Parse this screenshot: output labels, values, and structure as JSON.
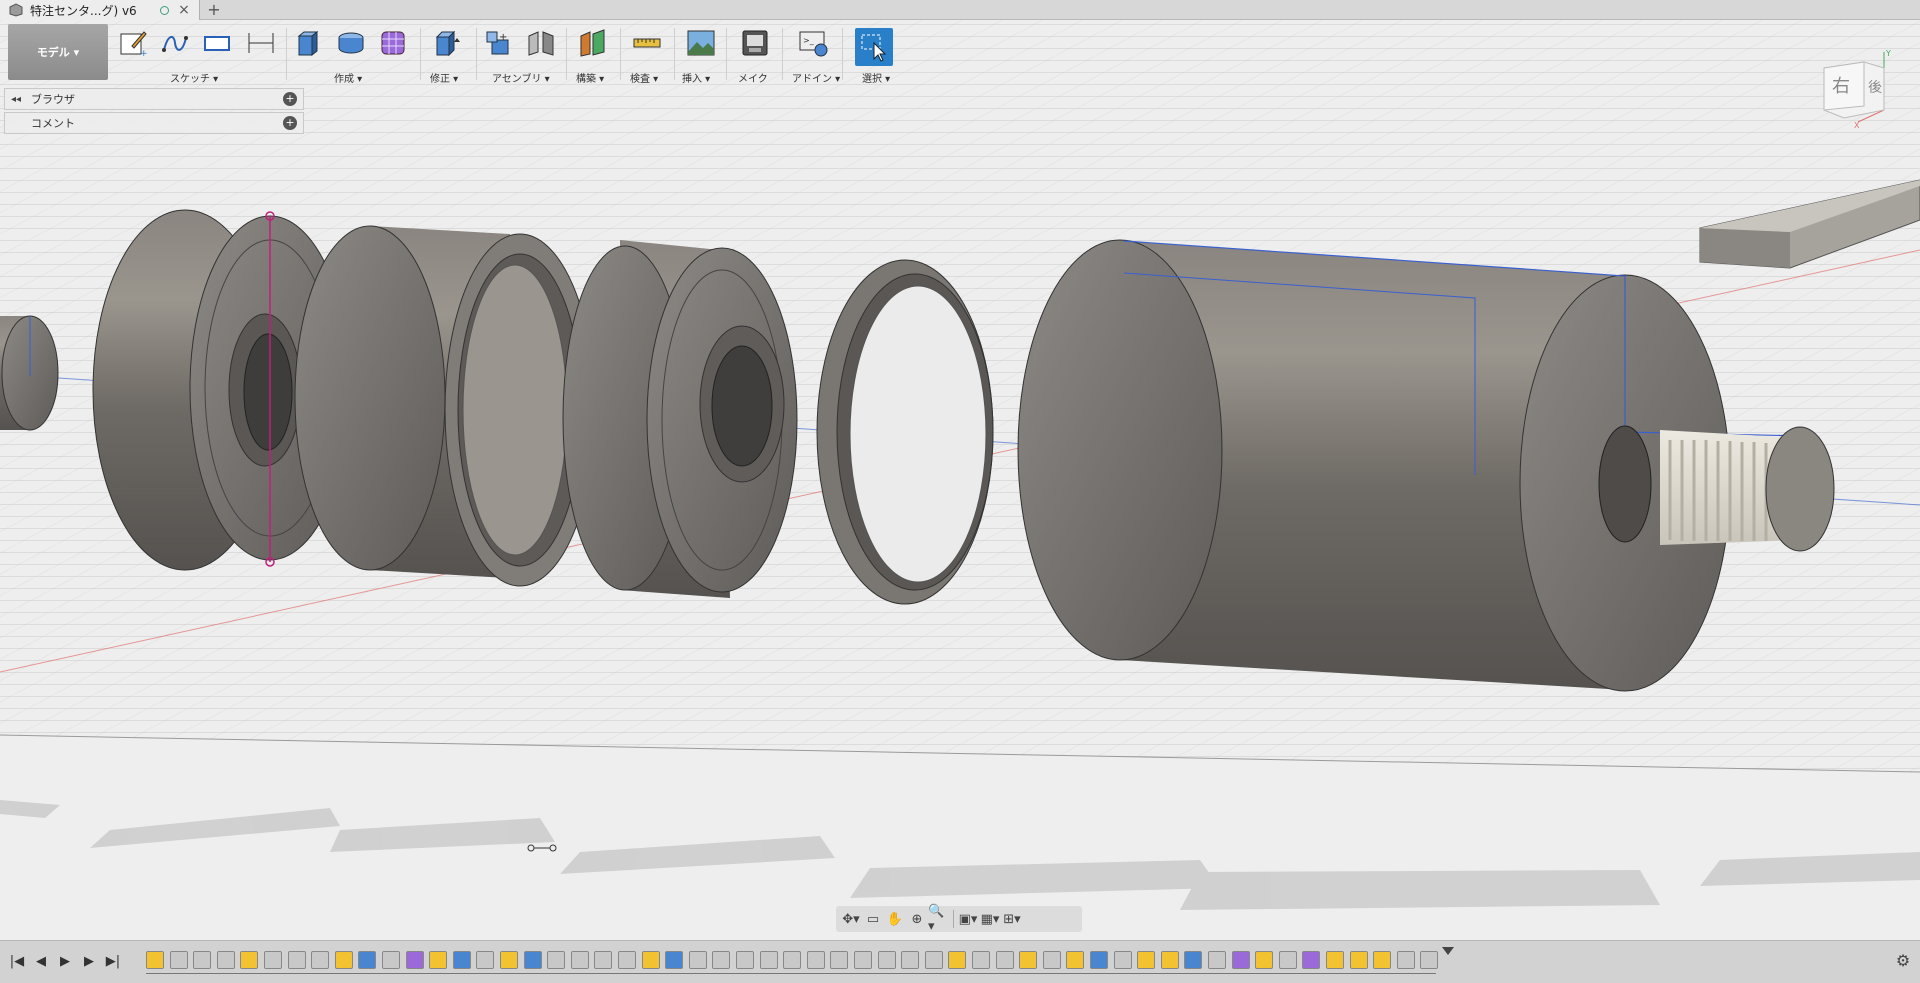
{
  "window": {
    "tab_title": "特注センタ...グ) v6",
    "new_tab": "+",
    "close_glyph": "×"
  },
  "toolbar": {
    "workspace_label": "モデル ▾",
    "groups": [
      {
        "label": "スケッチ ▾"
      },
      {
        "label": "作成 ▾"
      },
      {
        "label": "修正 ▾"
      },
      {
        "label": "アセンブリ ▾"
      },
      {
        "label": "構築 ▾"
      },
      {
        "label": "検査 ▾"
      },
      {
        "label": "挿入 ▾"
      },
      {
        "label": "メイク"
      },
      {
        "label": "アドイン ▾"
      },
      {
        "label": "選択 ▾"
      }
    ],
    "icons": [
      "create-sketch-icon",
      "spline-icon",
      "rectangle-icon",
      "dimension-icon",
      "extrude-icon",
      "revolve-icon",
      "form-icon",
      "press-pull-icon",
      "new-component-icon",
      "joint-icon",
      "offset-plane-icon",
      "measure-icon",
      "insert-image-icon",
      "make-icon",
      "scripts-icon",
      "select-icon"
    ],
    "accent": "#2a80c8"
  },
  "browser": {
    "label": "ブラウザ",
    "comments_label": "コメント"
  },
  "viewcube": {
    "front_face": "右",
    "side_face": "後",
    "axis_x": "X",
    "axis_y": "Y"
  },
  "navbar": {
    "icons": [
      "orbit-icon",
      "look-at-icon",
      "pan-icon",
      "zoom-icon",
      "fit-icon",
      "display-settings-icon",
      "grid-icon",
      "viewports-icon"
    ]
  },
  "timeline": {
    "controls": [
      "|◀",
      "◀",
      "▶",
      "▶",
      "▶|"
    ],
    "item_count": 55,
    "settings_glyph": "⚙"
  }
}
